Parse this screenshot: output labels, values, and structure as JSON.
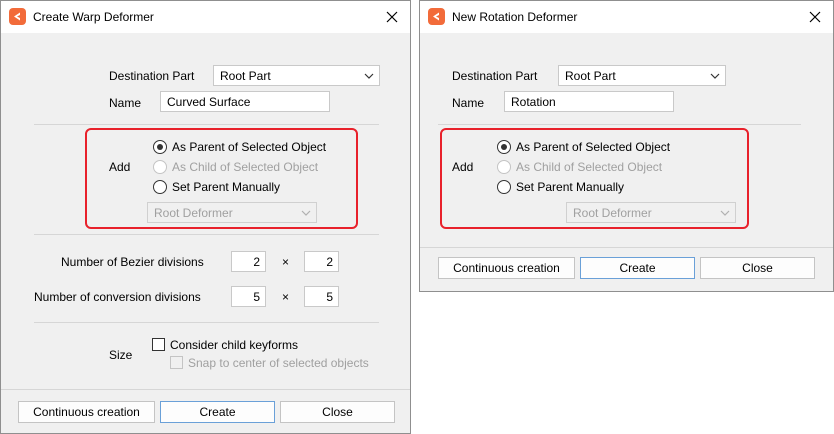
{
  "warp_dialog": {
    "title": "Create Warp Deformer",
    "destination_part_label": "Destination Part",
    "destination_part_value": "Root Part",
    "name_label": "Name",
    "name_value": "Curved Surface",
    "add_label": "Add",
    "radio_parent": "As Parent of Selected Object",
    "radio_child": "As Child of Selected Object",
    "radio_manual": "Set Parent Manually",
    "parent_select_value": "Root Deformer",
    "bezier_label": "Number of Bezier divisions",
    "bezier_x": "2",
    "bezier_y": "2",
    "conversion_label": "Number of conversion divisions",
    "conversion_x": "5",
    "conversion_y": "5",
    "times_symbol": "×",
    "size_label": "Size",
    "consider_keyforms": "Consider child keyforms",
    "snap_center": "Snap to center of selected objects",
    "btn_continuous": "Continuous creation",
    "btn_create": "Create",
    "btn_close": "Close"
  },
  "rotation_dialog": {
    "title": "New Rotation Deformer",
    "destination_part_label": "Destination Part",
    "destination_part_value": "Root Part",
    "name_label": "Name",
    "name_value": "Rotation",
    "add_label": "Add",
    "radio_parent": "As Parent of Selected Object",
    "radio_child": "As Child of Selected Object",
    "radio_manual": "Set Parent Manually",
    "parent_select_value": "Root Deformer",
    "btn_continuous": "Continuous creation",
    "btn_create": "Create",
    "btn_close": "Close"
  },
  "colors": {
    "highlight_box": "#e8212b",
    "app_icon": "#f26b3a",
    "dialog_bg": "#f0f0f0",
    "primary_border": "#6aa0d8"
  },
  "icons": {
    "app": "app-logo-icon",
    "close": "close-icon",
    "dropdown": "chevron-down-icon"
  }
}
